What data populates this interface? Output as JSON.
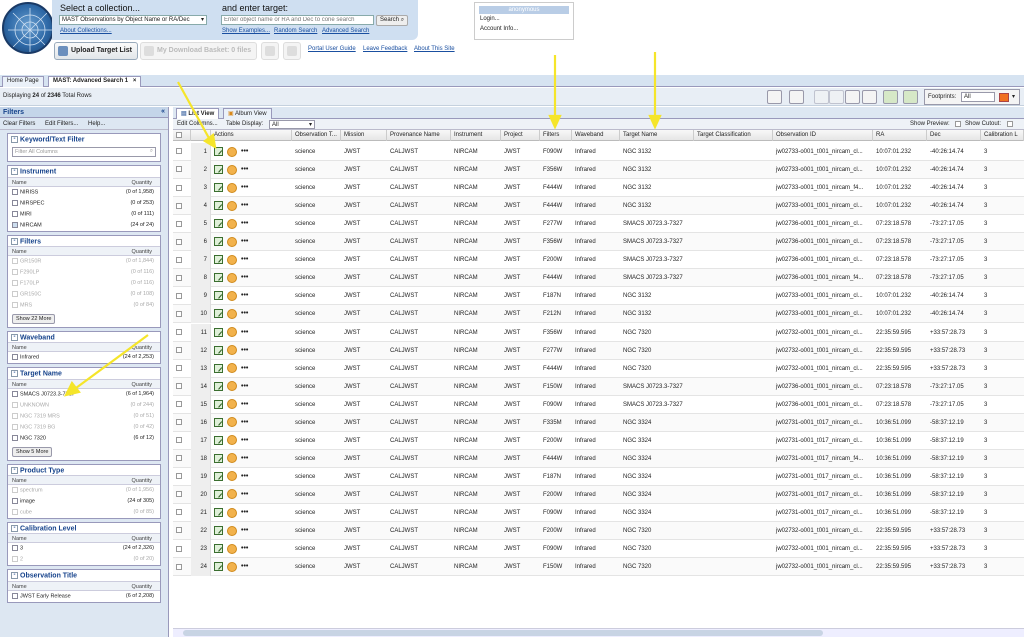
{
  "header": {
    "collection_prompt": "Select a collection...",
    "collection_value": "MAST Observations by Object Name or RA/Dec",
    "about_collections": "About Collections...",
    "target_prompt": "and enter target:",
    "target_placeholder": "Enter object name or RA and Dec to cone search",
    "search_button": "Search",
    "links": [
      "Show Examples...",
      "Random Search",
      "Advanced Search"
    ],
    "upload_button": "Upload Target List",
    "download_button": "My Download Basket: 0 files",
    "footer_links": [
      "Portal User Guide",
      "Leave Feedback",
      "About This Site"
    ]
  },
  "account": {
    "title": "anonymous",
    "items": [
      "Login...",
      "Account Info..."
    ]
  },
  "tabs": [
    "Home Page",
    "MAST: Advanced Search 1"
  ],
  "display_text": "Displaying 24 of 2346 Total Rows",
  "display_parts": {
    "prefix": "Displaying ",
    "shown": "24",
    "middle": " of ",
    "total": "2346",
    "suffix": " Total Rows"
  },
  "footprints": {
    "label": "Footprints:",
    "value": "All",
    "color": "#f07020"
  },
  "sidebar": {
    "title": "Filters",
    "tools": [
      "Clear Filters",
      "Edit Filters...",
      "Help..."
    ],
    "keyword": {
      "title": "Keyword/Text Filter",
      "placeholder": "Filter All Columns"
    },
    "name_header": "Name",
    "qty_header": "Quantity",
    "instrument": {
      "title": "Instrument",
      "rows": [
        {
          "name": "NIRISS",
          "qty": "(0 of 1,958)",
          "dim": false
        },
        {
          "name": "NIRSPEC",
          "qty": "(0 of 253)",
          "dim": false
        },
        {
          "name": "MIRI",
          "qty": "(0 of 111)",
          "dim": false
        },
        {
          "name": "NIRCAM",
          "qty": "(24 of 24)",
          "dim": false
        }
      ]
    },
    "filters": {
      "title": "Filters",
      "rows": [
        {
          "name": "GR150R",
          "qty": "(0 of 1,844)"
        },
        {
          "name": "F290LP",
          "qty": "(0 of 116)"
        },
        {
          "name": "F170LP",
          "qty": "(0 of 116)"
        },
        {
          "name": "GR150C",
          "qty": "(0 of 108)"
        },
        {
          "name": "MRS",
          "qty": "(0 of 84)"
        }
      ],
      "more": "Show 22 More"
    },
    "waveband": {
      "title": "Waveband",
      "rows": [
        {
          "name": "Infrared",
          "qty": "(24 of 2,253)"
        }
      ]
    },
    "target_name": {
      "title": "Target Name",
      "rows": [
        {
          "name": "SMACS J0723.3-7327",
          "qty": "(6 of 1,964)",
          "dim": false
        },
        {
          "name": "UNKNOWN",
          "qty": "(0 of 244)",
          "dim": true
        },
        {
          "name": "NGC 7319 MRS",
          "qty": "(0 of 51)",
          "dim": true
        },
        {
          "name": "NGC 7319 BG",
          "qty": "(0 of 42)",
          "dim": true
        },
        {
          "name": "NGC 7320",
          "qty": "(6 of 12)",
          "dim": false
        }
      ],
      "more": "Show 5 More"
    },
    "product_type": {
      "title": "Product Type",
      "rows": [
        {
          "name": "spectrum",
          "qty": "(0 of 1,956)",
          "dim": true
        },
        {
          "name": "image",
          "qty": "(24 of 305)",
          "dim": false
        },
        {
          "name": "cube",
          "qty": "(0 of 85)",
          "dim": true
        }
      ]
    },
    "calibration": {
      "title": "Calibration Level",
      "rows": [
        {
          "name": "3",
          "qty": "(24 of 2,326)",
          "dim": false
        },
        {
          "name": "2",
          "qty": "(0 of 20)",
          "dim": true
        }
      ]
    },
    "obs_title": {
      "title": "Observation Title",
      "rows": [
        {
          "name": "JWST Early Release",
          "qty": "(6 of 2,208)",
          "dim": false
        }
      ]
    }
  },
  "grid": {
    "tabs": [
      "List View",
      "Album View"
    ],
    "edit_columns": "Edit Columns...",
    "table_display_label": "Table Display:",
    "table_display_value": "All",
    "show_preview": "Show Preview:",
    "show_cutout": "Show Cutout:",
    "columns": [
      "Actions",
      "Observation T...",
      "Mission",
      "Provenance Name",
      "Instrument",
      "Project",
      "Filters",
      "Waveband",
      "Target Name",
      "Target Classification",
      "Observation ID",
      "RA",
      "Dec",
      "Calibration L"
    ],
    "rows": [
      [
        "1",
        "science",
        "JWST",
        "CALJWST",
        "NIRCAM",
        "JWST",
        "F090W",
        "Infrared",
        "NGC 3132",
        "",
        "jw02733-o001_t001_nircam_cl...",
        "10:07:01.232",
        "-40:26:14.74",
        "3"
      ],
      [
        "2",
        "science",
        "JWST",
        "CALJWST",
        "NIRCAM",
        "JWST",
        "F356W",
        "Infrared",
        "NGC 3132",
        "",
        "jw02733-o001_t001_nircam_cl...",
        "10:07:01.232",
        "-40:26:14.74",
        "3"
      ],
      [
        "3",
        "science",
        "JWST",
        "CALJWST",
        "NIRCAM",
        "JWST",
        "F444W",
        "Infrared",
        "NGC 3132",
        "",
        "jw02733-o001_t001_nircam_f4...",
        "10:07:01.232",
        "-40:26:14.74",
        "3"
      ],
      [
        "4",
        "science",
        "JWST",
        "CALJWST",
        "NIRCAM",
        "JWST",
        "F444W",
        "Infrared",
        "NGC 3132",
        "",
        "jw02733-o001_t001_nircam_cl...",
        "10:07:01.232",
        "-40:26:14.74",
        "3"
      ],
      [
        "5",
        "science",
        "JWST",
        "CALJWST",
        "NIRCAM",
        "JWST",
        "F277W",
        "Infrared",
        "SMACS J0723.3-7327",
        "",
        "jw02736-o001_t001_nircam_cl...",
        "07:23:18.578",
        "-73:27:17.05",
        "3"
      ],
      [
        "6",
        "science",
        "JWST",
        "CALJWST",
        "NIRCAM",
        "JWST",
        "F356W",
        "Infrared",
        "SMACS J0723.3-7327",
        "",
        "jw02736-o001_t001_nircam_cl...",
        "07:23:18.578",
        "-73:27:17.05",
        "3"
      ],
      [
        "7",
        "science",
        "JWST",
        "CALJWST",
        "NIRCAM",
        "JWST",
        "F200W",
        "Infrared",
        "SMACS J0723.3-7327",
        "",
        "jw02736-o001_t001_nircam_cl...",
        "07:23:18.578",
        "-73:27:17.05",
        "3"
      ],
      [
        "8",
        "science",
        "JWST",
        "CALJWST",
        "NIRCAM",
        "JWST",
        "F444W",
        "Infrared",
        "SMACS J0723.3-7327",
        "",
        "jw02736-o001_t001_nircam_f4...",
        "07:23:18.578",
        "-73:27:17.05",
        "3"
      ],
      [
        "9",
        "science",
        "JWST",
        "CALJWST",
        "NIRCAM",
        "JWST",
        "F187N",
        "Infrared",
        "NGC 3132",
        "",
        "jw02733-o001_t001_nircam_cl...",
        "10:07:01.232",
        "-40:26:14.74",
        "3"
      ],
      [
        "10",
        "science",
        "JWST",
        "CALJWST",
        "NIRCAM",
        "JWST",
        "F212N",
        "Infrared",
        "NGC 3132",
        "",
        "jw02733-o001_t001_nircam_cl...",
        "10:07:01.232",
        "-40:26:14.74",
        "3"
      ],
      [
        "11",
        "science",
        "JWST",
        "CALJWST",
        "NIRCAM",
        "JWST",
        "F356W",
        "Infrared",
        "NGC 7320",
        "",
        "jw02732-o001_t001_nircam_cl...",
        "22:35:59.595",
        "+33:57:28.73",
        "3"
      ],
      [
        "12",
        "science",
        "JWST",
        "CALJWST",
        "NIRCAM",
        "JWST",
        "F277W",
        "Infrared",
        "NGC 7320",
        "",
        "jw02732-o001_t001_nircam_cl...",
        "22:35:59.595",
        "+33:57:28.73",
        "3"
      ],
      [
        "13",
        "science",
        "JWST",
        "CALJWST",
        "NIRCAM",
        "JWST",
        "F444W",
        "Infrared",
        "NGC 7320",
        "",
        "jw02732-o001_t001_nircam_cl...",
        "22:35:59.595",
        "+33:57:28.73",
        "3"
      ],
      [
        "14",
        "science",
        "JWST",
        "CALJWST",
        "NIRCAM",
        "JWST",
        "F150W",
        "Infrared",
        "SMACS J0723.3-7327",
        "",
        "jw02736-o001_t001_nircam_cl...",
        "07:23:18.578",
        "-73:27:17.05",
        "3"
      ],
      [
        "15",
        "science",
        "JWST",
        "CALJWST",
        "NIRCAM",
        "JWST",
        "F090W",
        "Infrared",
        "SMACS J0723.3-7327",
        "",
        "jw02736-o001_t001_nircam_cl...",
        "07:23:18.578",
        "-73:27:17.05",
        "3"
      ],
      [
        "16",
        "science",
        "JWST",
        "CALJWST",
        "NIRCAM",
        "JWST",
        "F335M",
        "Infrared",
        "NGC 3324",
        "",
        "jw02731-o001_t017_nircam_cl...",
        "10:36:51.099",
        "-58:37:12.19",
        "3"
      ],
      [
        "17",
        "science",
        "JWST",
        "CALJWST",
        "NIRCAM",
        "JWST",
        "F200W",
        "Infrared",
        "NGC 3324",
        "",
        "jw02731-o001_t017_nircam_cl...",
        "10:36:51.099",
        "-58:37:12.19",
        "3"
      ],
      [
        "18",
        "science",
        "JWST",
        "CALJWST",
        "NIRCAM",
        "JWST",
        "F444W",
        "Infrared",
        "NGC 3324",
        "",
        "jw02731-o001_t017_nircam_f4...",
        "10:36:51.099",
        "-58:37:12.19",
        "3"
      ],
      [
        "19",
        "science",
        "JWST",
        "CALJWST",
        "NIRCAM",
        "JWST",
        "F187N",
        "Infrared",
        "NGC 3324",
        "",
        "jw02731-o001_t017_nircam_cl...",
        "10:36:51.099",
        "-58:37:12.19",
        "3"
      ],
      [
        "20",
        "science",
        "JWST",
        "CALJWST",
        "NIRCAM",
        "JWST",
        "F200W",
        "Infrared",
        "NGC 3324",
        "",
        "jw02731-o001_t017_nircam_cl...",
        "10:36:51.099",
        "-58:37:12.19",
        "3"
      ],
      [
        "21",
        "science",
        "JWST",
        "CALJWST",
        "NIRCAM",
        "JWST",
        "F090W",
        "Infrared",
        "NGC 3324",
        "",
        "jw02731-o001_t017_nircam_cl...",
        "10:36:51.099",
        "-58:37:12.19",
        "3"
      ],
      [
        "22",
        "science",
        "JWST",
        "CALJWST",
        "NIRCAM",
        "JWST",
        "F200W",
        "Infrared",
        "NGC 7320",
        "",
        "jw02732-o001_t001_nircam_cl...",
        "22:35:59.595",
        "+33:57:28.73",
        "3"
      ],
      [
        "23",
        "science",
        "JWST",
        "CALJWST",
        "NIRCAM",
        "JWST",
        "F090W",
        "Infrared",
        "NGC 7320",
        "",
        "jw02732-o001_t001_nircam_cl...",
        "22:35:59.595",
        "+33:57:28.73",
        "3"
      ],
      [
        "24",
        "science",
        "JWST",
        "CALJWST",
        "NIRCAM",
        "JWST",
        "F150W",
        "Infrared",
        "NGC 7320",
        "",
        "jw02732-o001_t001_nircam_cl...",
        "22:35:59.595",
        "+33:57:28.73",
        "3"
      ]
    ]
  },
  "colors": {
    "accent": "#15428b",
    "panel": "#cfdff1",
    "arrow": "#f5e52a"
  }
}
